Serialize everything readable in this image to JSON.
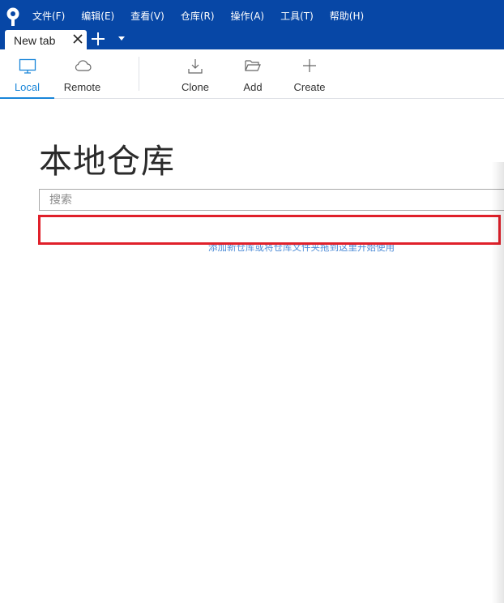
{
  "menu": [
    "文件(F)",
    "编辑(E)",
    "查看(V)",
    "仓库(R)",
    "操作(A)",
    "工具(T)",
    "帮助(H)"
  ],
  "tab": {
    "label": "New tab"
  },
  "toolbar": {
    "local": "Local",
    "remote": "Remote",
    "clone": "Clone",
    "add": "Add",
    "create": "Create"
  },
  "main": {
    "title": "本地仓库",
    "search_placeholder": "搜索",
    "empty_hint": "添加新仓库或将仓库文件夹拖到这里开始使用"
  },
  "colors": {
    "chrome": "#0747a6",
    "accent": "#1a86d9",
    "highlight": "#e0202a"
  }
}
